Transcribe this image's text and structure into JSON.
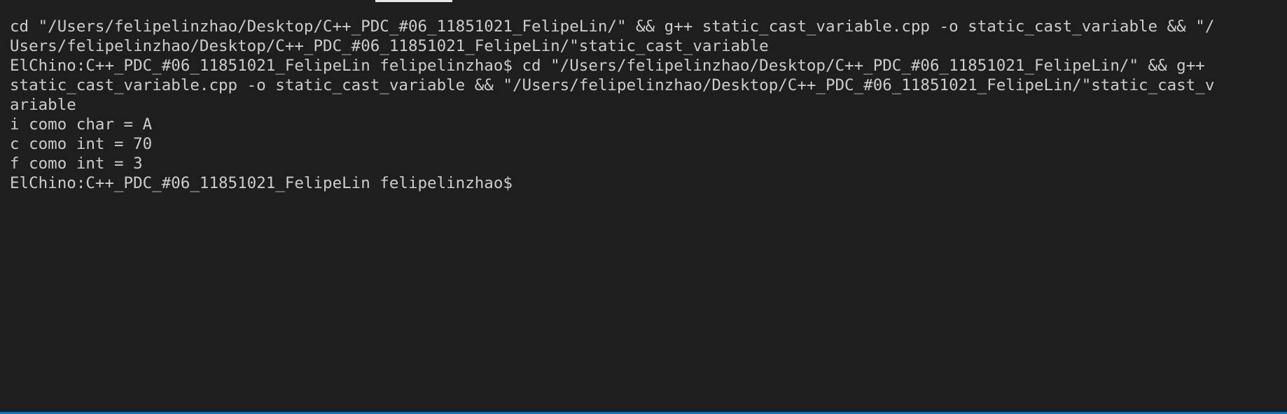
{
  "terminal": {
    "lines": [
      "cd \"/Users/felipelinzhao/Desktop/C++_PDC_#06_11851021_FelipeLin/\" && g++ static_cast_variable.cpp -o static_cast_variable && \"/",
      "Users/felipelinzhao/Desktop/C++_PDC_#06_11851021_FelipeLin/\"static_cast_variable",
      "ElChino:C++_PDC_#06_11851021_FelipeLin felipelinzhao$ cd \"/Users/felipelinzhao/Desktop/C++_PDC_#06_11851021_FelipeLin/\" && g++",
      "static_cast_variable.cpp -o static_cast_variable && \"/Users/felipelinzhao/Desktop/C++_PDC_#06_11851021_FelipeLin/\"static_cast_v",
      "ariable",
      "i como char = A",
      "c como int = 70",
      "f como int = 3"
    ],
    "prompt": "ElChino:C++_PDC_#06_11851021_FelipeLin felipelinzhao$"
  },
  "colors": {
    "background": "#1e1e1e",
    "text": "#cccccc",
    "status_bar": "#007acc",
    "tab_indicator": "#e7e7e7"
  }
}
